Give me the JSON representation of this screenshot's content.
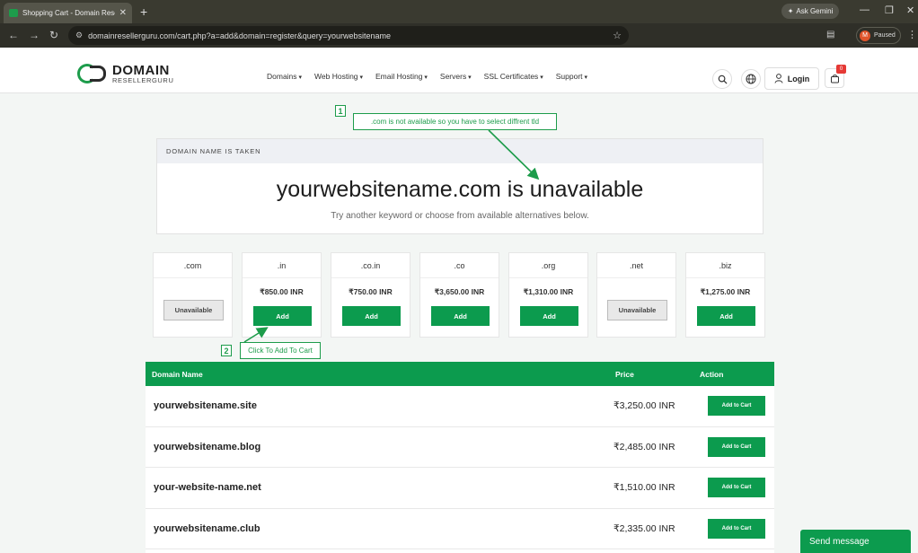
{
  "browser": {
    "tab_title": "Shopping Cart - Domain Resell...",
    "tab_close": "✕",
    "new_tab": "+",
    "url": "domainresellerguru.com/cart.php?a=add&domain=register&query=yourwebsitename",
    "ask_gemini": "Ask Gemini",
    "profile_initial": "M",
    "profile_status": "Paused"
  },
  "site": {
    "logo_line1": "DOMAIN",
    "logo_line2": "RESELLERGURU",
    "nav": [
      "Domains",
      "Web Hosting",
      "Email Hosting",
      "Servers",
      "SSL Certificates",
      "Support"
    ],
    "login": "Login",
    "cart_count": "0"
  },
  "annotations": {
    "one": {
      "num": "1",
      "text": ".com is not available so you have to select diffrent tld"
    },
    "two": {
      "num": "2",
      "text": "Click To Add To Cart"
    }
  },
  "taken": {
    "header": "DOMAIN NAME IS TAKEN",
    "title": "yourwebsitename.com is unavailable",
    "subtitle": "Try another keyword or choose from available alternatives below."
  },
  "tlds": [
    {
      "ext": ".com",
      "price": "",
      "action": "Unavailable",
      "available": false
    },
    {
      "ext": ".in",
      "price": "₹850.00 INR",
      "action": "Add",
      "available": true
    },
    {
      "ext": ".co.in",
      "price": "₹750.00 INR",
      "action": "Add",
      "available": true
    },
    {
      "ext": ".co",
      "price": "₹3,650.00 INR",
      "action": "Add",
      "available": true
    },
    {
      "ext": ".org",
      "price": "₹1,310.00 INR",
      "action": "Add",
      "available": true
    },
    {
      "ext": ".net",
      "price": "",
      "action": "Unavailable",
      "available": false
    },
    {
      "ext": ".biz",
      "price": "₹1,275.00 INR",
      "action": "Add",
      "available": true
    }
  ],
  "suggestions": {
    "columns": {
      "name": "Domain Name",
      "price": "Price",
      "action": "Action"
    },
    "rows": [
      {
        "name": "yourwebsitename.site",
        "price": "₹3,250.00 INR",
        "action": "Add to Cart"
      },
      {
        "name": "yourwebsitename.blog",
        "price": "₹2,485.00 INR",
        "action": "Add to Cart"
      },
      {
        "name": "your-website-name.net",
        "price": "₹1,510.00 INR",
        "action": "Add to Cart"
      },
      {
        "name": "yourwebsitename.club",
        "price": "₹2,335.00 INR",
        "action": "Add to Cart"
      }
    ]
  },
  "chat": {
    "send_message": "Send message"
  },
  "colors": {
    "brand_green": "#0c9b4e",
    "annotation_green": "#1d9c4b",
    "badge_red": "#e53935"
  },
  "icons": [
    "search-icon",
    "globe-icon",
    "user-icon",
    "cart-icon",
    "back-icon",
    "forward-icon",
    "reload-icon",
    "star-icon",
    "close-icon",
    "minimize-icon",
    "maximize-icon"
  ]
}
